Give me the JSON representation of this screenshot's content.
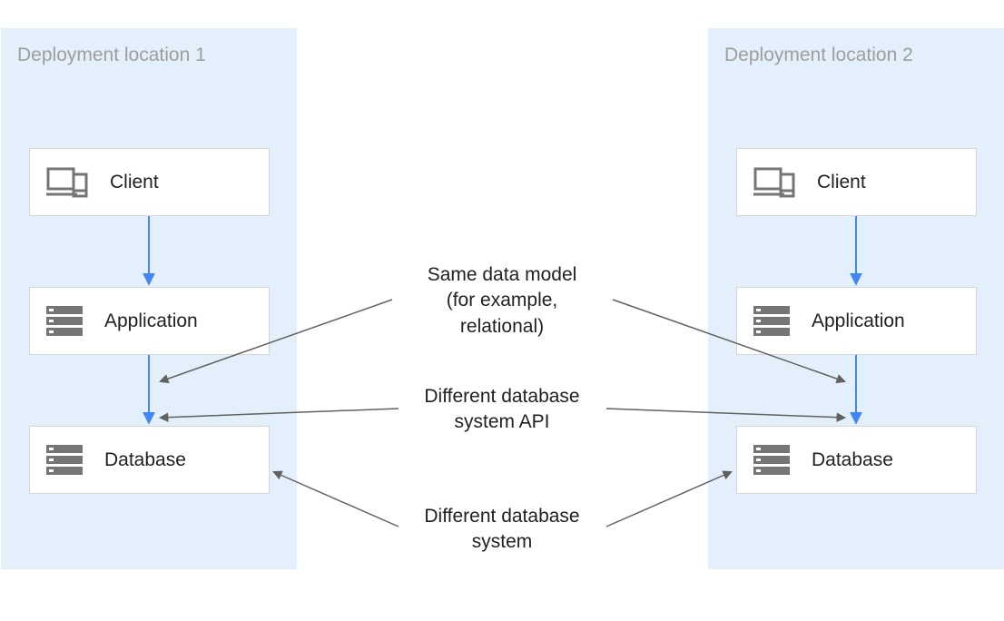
{
  "regions": {
    "left": {
      "title": "Deployment location 1"
    },
    "right": {
      "title": "Deployment location 2"
    }
  },
  "nodes": {
    "client": "Client",
    "application": "Application",
    "database": "Database"
  },
  "annotations": {
    "data_model_line1": "Same data model",
    "data_model_line2": "(for example,",
    "data_model_line3": "relational)",
    "api_line1": "Different database",
    "api_line2": "system API",
    "system_line1": "Different database",
    "system_line2": "system"
  },
  "colors": {
    "region_bg": "#e3f0fb",
    "region_title": "#9e9e9e",
    "node_border": "#d6d6d6",
    "arrow_blue": "#4285f4",
    "arrow_dark": "#616161",
    "icon_gray": "#757575"
  }
}
